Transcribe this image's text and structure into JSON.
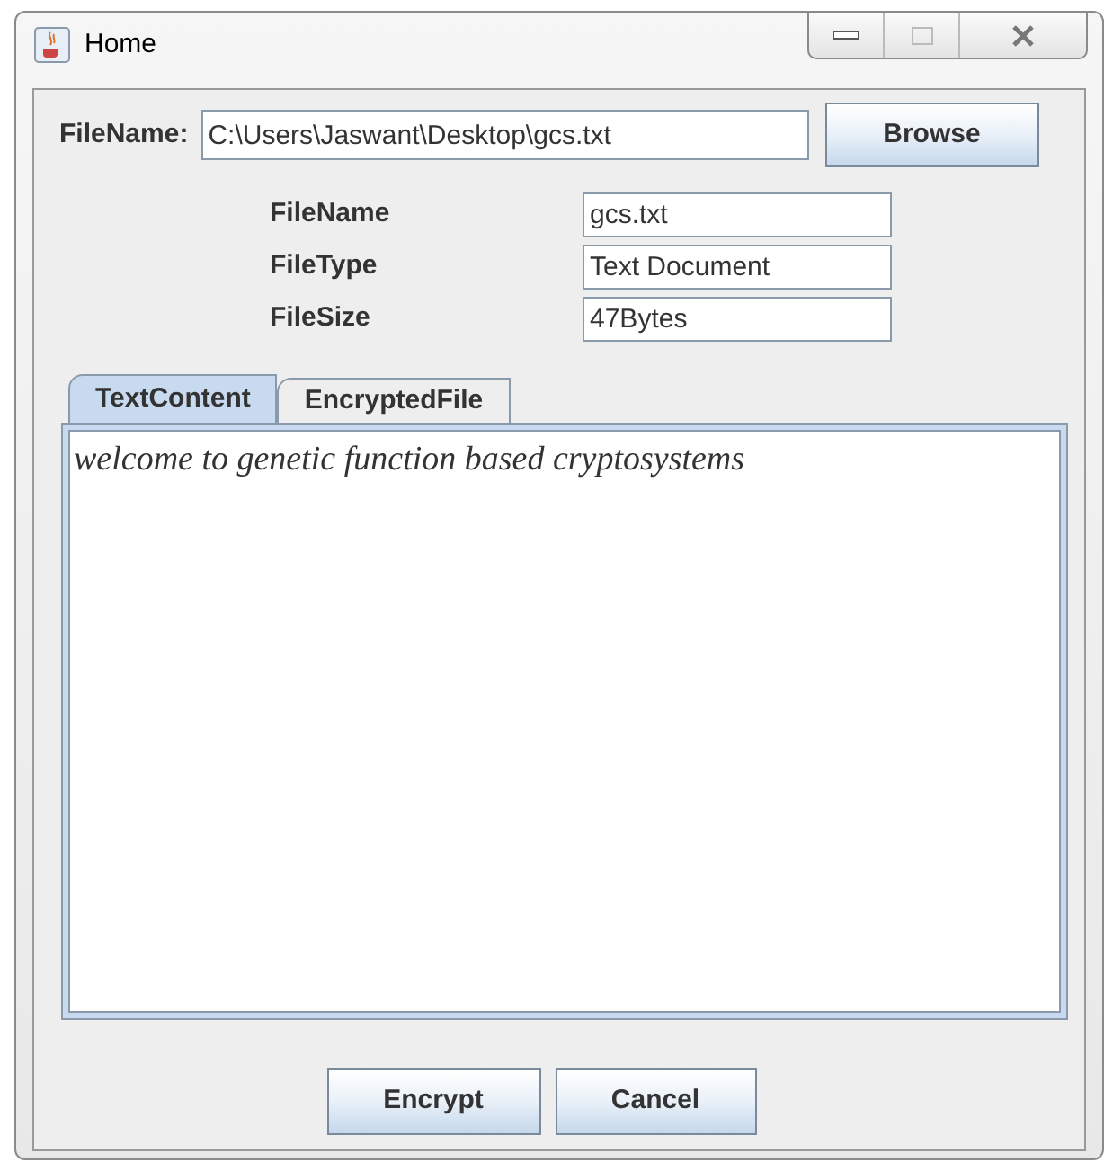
{
  "window": {
    "title": "Home"
  },
  "file_name": {
    "label": "FileName:",
    "value": "C:\\Users\\Jaswant\\Desktop\\gcs.txt"
  },
  "browse_button": "Browse",
  "info": [
    {
      "label": "FileName",
      "value": "gcs.txt"
    },
    {
      "label": "FileType",
      "value": "Text Document"
    },
    {
      "label": "FileSize",
      "value": "47Bytes"
    }
  ],
  "tabs": [
    {
      "label": "TextContent",
      "selected": true
    },
    {
      "label": "EncryptedFile",
      "selected": false
    }
  ],
  "text_content": "welcome to genetic function based cryptosystems",
  "buttons": [
    "Encrypt",
    "Cancel"
  ]
}
